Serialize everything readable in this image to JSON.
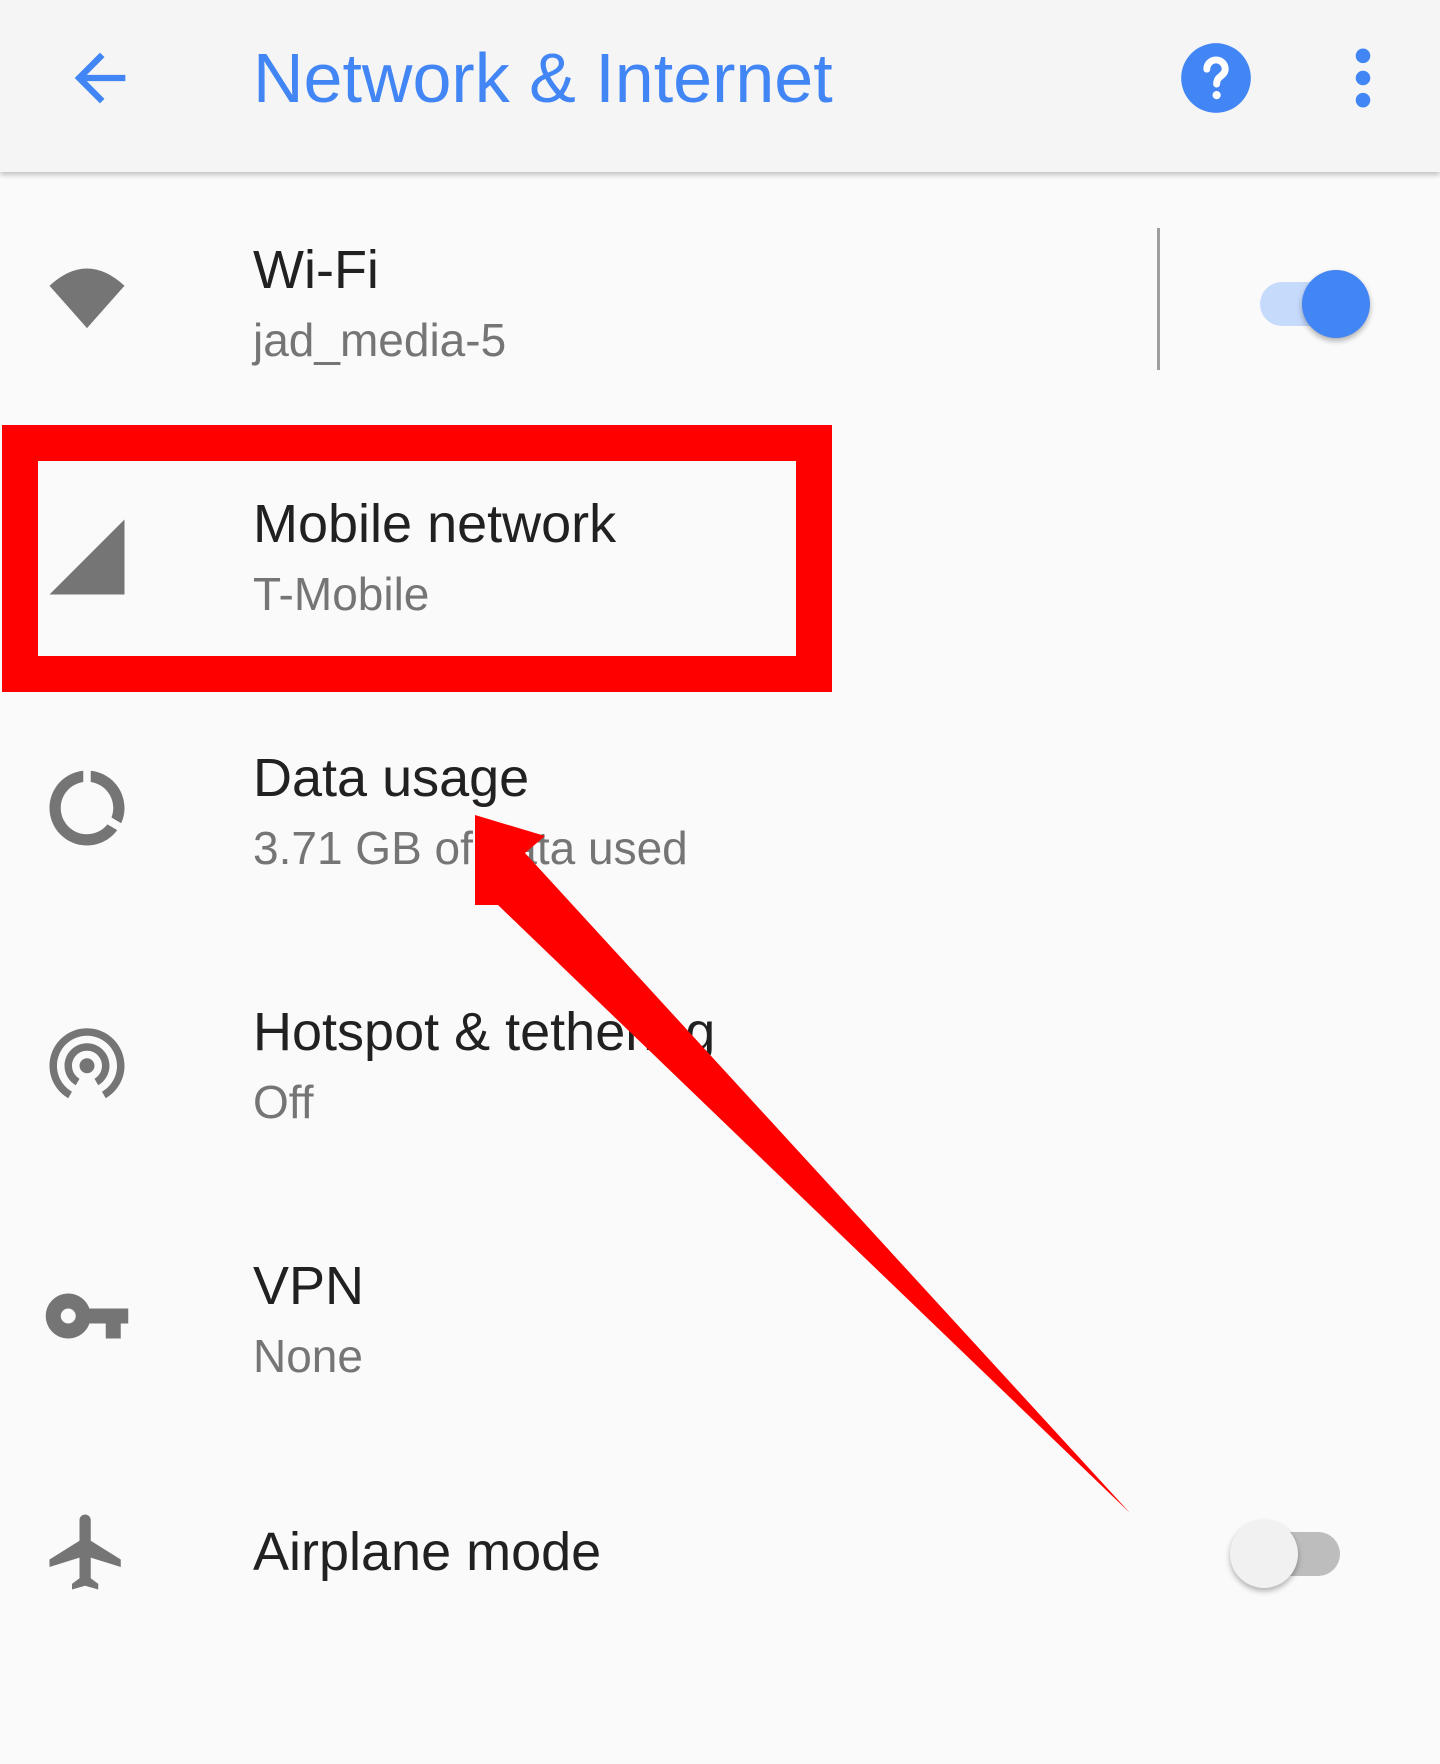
{
  "header": {
    "title": "Network & Internet",
    "back_icon": "arrow-back-icon",
    "help_icon": "help-circle-icon",
    "more_icon": "more-vertical-icon"
  },
  "items": [
    {
      "title": "Wi-Fi",
      "subtitle": "jad_media-5",
      "icon": "wifi-icon",
      "toggle": true
    },
    {
      "title": "Mobile network",
      "subtitle": "T-Mobile",
      "icon": "cellular-signal-icon"
    },
    {
      "title": "Data usage",
      "subtitle": "3.71 GB of data used",
      "icon": "data-usage-icon"
    },
    {
      "title": "Hotspot & tethering",
      "subtitle": "Off",
      "icon": "hotspot-icon"
    },
    {
      "title": "VPN",
      "subtitle": "None",
      "icon": "vpn-key-icon"
    },
    {
      "title": "Airplane mode",
      "icon": "airplane-icon",
      "toggle": false
    }
  ],
  "colors": {
    "accent": "#4285f4",
    "annotation": "#ff0000",
    "icon_gray": "#757575"
  }
}
